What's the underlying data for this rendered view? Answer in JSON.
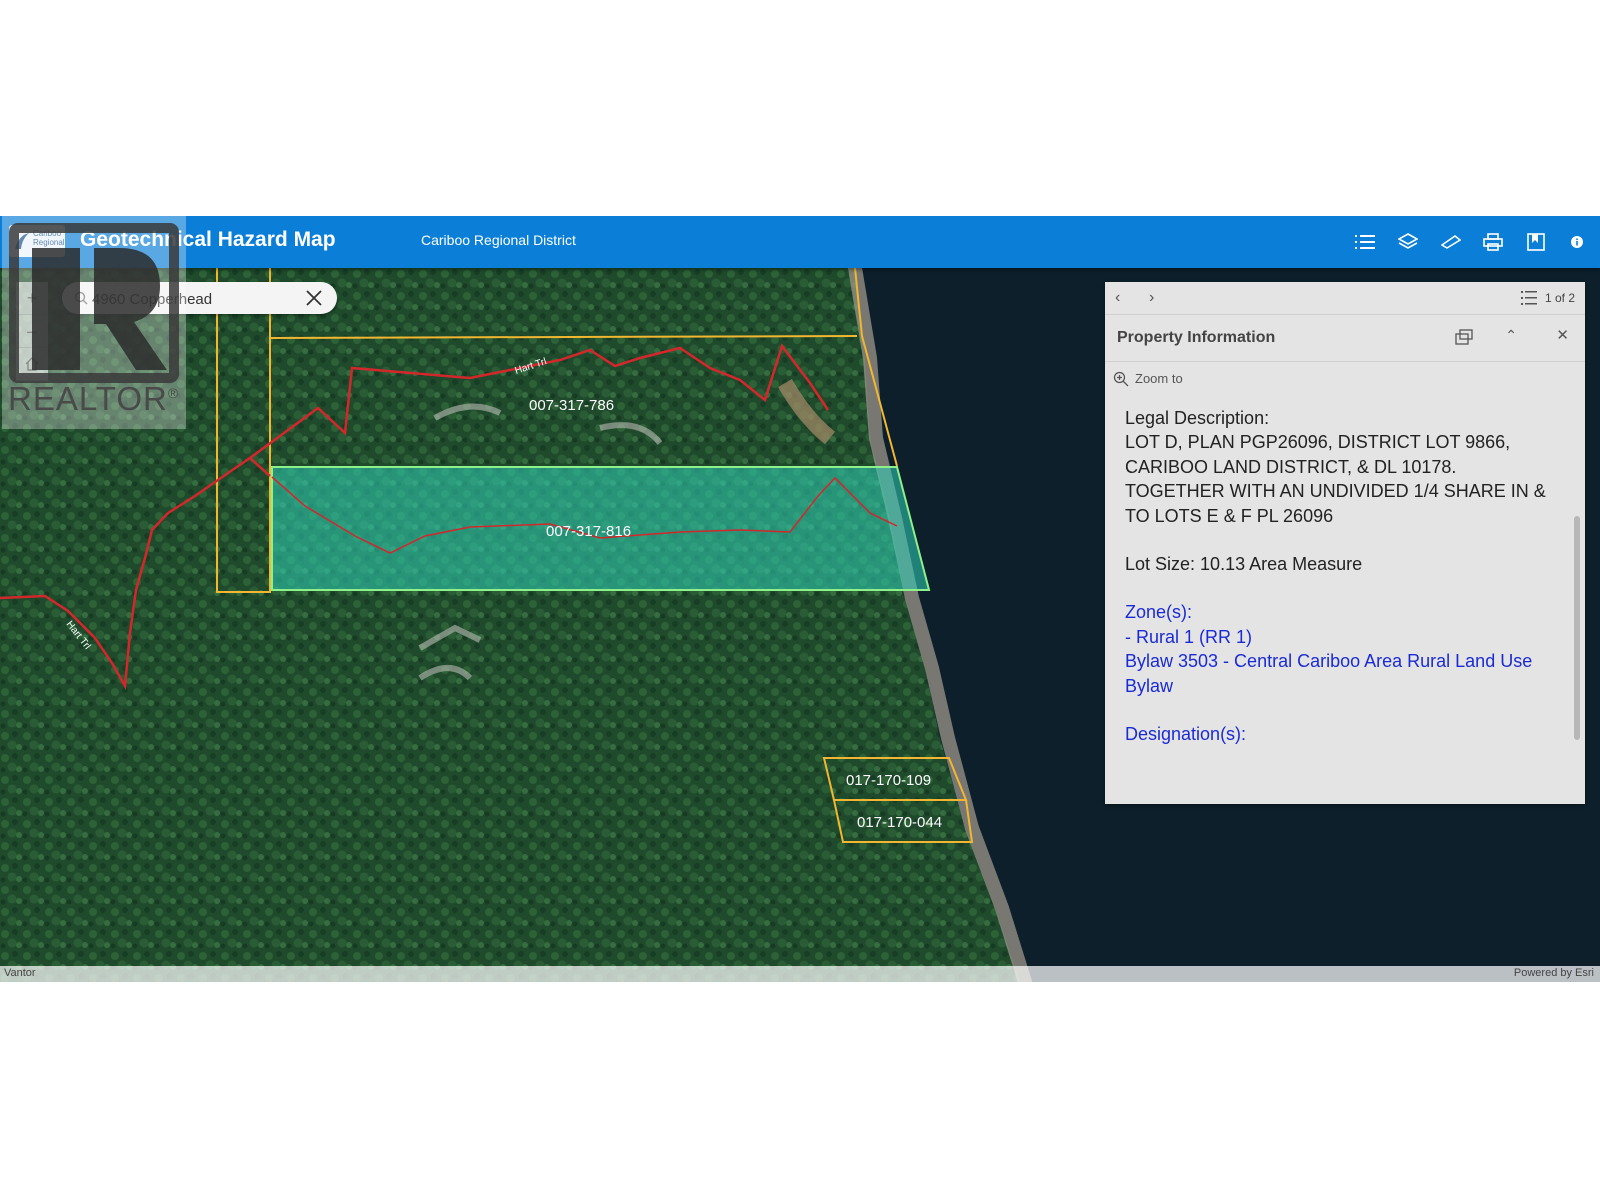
{
  "header": {
    "logo_text": "Cariboo Regional",
    "title": "Geotechnical Hazard Map",
    "subtitle": "Cariboo Regional District",
    "tools": [
      "list-icon",
      "layers-icon",
      "measure-icon",
      "print-icon",
      "bookmark-icon",
      "info-icon"
    ]
  },
  "search": {
    "value": "4960 Copperhead"
  },
  "zoom_controls": {
    "zoom_in": "+",
    "zoom_out": "–"
  },
  "watermark": {
    "text": "REALTOR",
    "mark": "®"
  },
  "map": {
    "parcels": [
      "007-317-786",
      "007-317-816",
      "017-170-109",
      "017-170-044"
    ],
    "roads": [
      "Hart Trl",
      "Hart Trl"
    ],
    "selected_parcel": "007-317-816",
    "colors": {
      "parcel_outline": "#f2b630",
      "selected_fill": "#2fd1b8",
      "selected_outline": "#8df089",
      "trail": "#d4272b",
      "water": "#0c1f2b"
    }
  },
  "attribution": {
    "left": "Vantor",
    "right": "Powered by Esri"
  },
  "panel": {
    "count": "1 of 2",
    "title": "Property Information",
    "zoom_to": "Zoom to",
    "legal_label": "Legal Description:",
    "legal_text": "LOT D, PLAN PGP26096, DISTRICT LOT 9866, CARIBOO LAND DISTRICT, & DL 10178. TOGETHER WITH AN UNDIVIDED 1/4 SHARE IN & TO LOTS E & F PL 26096",
    "lot_size": "Lot Size: 10.13 Area Measure",
    "zones_label": "Zone(s):",
    "zone_value": "- Rural 1 (RR 1)",
    "bylaw": "Bylaw 3503 - Central Cariboo Area Rural Land Use Bylaw",
    "designations_label": "Designation(s):",
    "scroll_fraction": 0.3
  }
}
